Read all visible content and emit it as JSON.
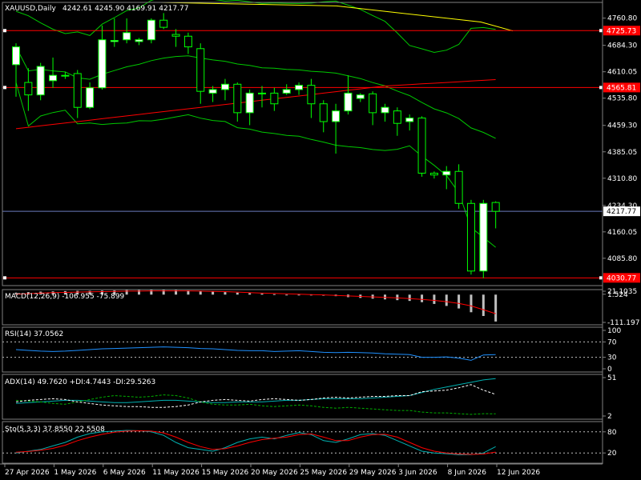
{
  "header": {
    "symbol": "XAUUSD,Daily",
    "ohlc": "4242.61 4245.90 4169.91 4217.77"
  },
  "colors": {
    "background": "#000000",
    "separator": "#808080",
    "bull": "#ffffff",
    "bear": "#000000",
    "wick": "#00ff00",
    "bollinger": "#00c800",
    "slow_ma": "#ff0000",
    "long_ma": "#ffff00",
    "hline": "#ff0000",
    "bid_line": "#6a7bbd",
    "macd_hist": "#c0c0c0",
    "macd_signal": "#ff0000",
    "rsi": "#1e90ff",
    "adx_main": "#00b0b0",
    "adx_dip": "#00b000",
    "adx_dim": "#ffffff",
    "sto_main": "#00b0b0",
    "sto_signal": "#ff0000",
    "label_red_bg": "#ff0000",
    "label_white_bg": "#ffffff"
  },
  "price_panel": {
    "ylim": [
      4009.0,
      4805.0
    ],
    "tick_labels": [
      "4760.80",
      "4684.30",
      "4610.05",
      "4535.80",
      "4459.30",
      "4385.05",
      "4310.80",
      "4234.30",
      "4160.05",
      "4085.80"
    ],
    "tick_values": [
      4760.8,
      4684.3,
      4610.05,
      4535.8,
      4459.3,
      4385.05,
      4310.8,
      4234.3,
      4160.05,
      4085.8
    ],
    "hlines": [
      {
        "label": "4725.73",
        "value": 4725.73
      },
      {
        "label": "4565.81",
        "value": 4565.81
      },
      {
        "label": "4030.77",
        "value": 4030.77
      }
    ],
    "current_price": {
      "label": "4217.77",
      "value": 4217.77
    }
  },
  "chart_data": {
    "type": "candlestick",
    "series": [
      {
        "name": "XAUUSD,Daily",
        "candles": [
          {
            "o": 4630,
            "h": 4690,
            "l": 4540,
            "c": 4680
          },
          {
            "o": 4580,
            "h": 4620,
            "l": 4500,
            "c": 4545
          },
          {
            "o": 4545,
            "h": 4635,
            "l": 4530,
            "c": 4625
          },
          {
            "o": 4585,
            "h": 4650,
            "l": 4565,
            "c": 4600
          },
          {
            "o": 4600,
            "h": 4610,
            "l": 4590,
            "c": 4598
          },
          {
            "o": 4605,
            "h": 4615,
            "l": 4480,
            "c": 4510
          },
          {
            "o": 4510,
            "h": 4580,
            "l": 4505,
            "c": 4565
          },
          {
            "o": 4565,
            "h": 4740,
            "l": 4560,
            "c": 4700
          },
          {
            "o": 4695,
            "h": 4760,
            "l": 4680,
            "c": 4698
          },
          {
            "o": 4700,
            "h": 4760,
            "l": 4690,
            "c": 4720
          },
          {
            "o": 4695,
            "h": 4705,
            "l": 4685,
            "c": 4700
          },
          {
            "o": 4700,
            "h": 4760,
            "l": 4690,
            "c": 4755
          },
          {
            "o": 4755,
            "h": 4775,
            "l": 4730,
            "c": 4735
          },
          {
            "o": 4715,
            "h": 4730,
            "l": 4680,
            "c": 4710
          },
          {
            "o": 4710,
            "h": 4720,
            "l": 4660,
            "c": 4680
          },
          {
            "o": 4675,
            "h": 4690,
            "l": 4520,
            "c": 4555
          },
          {
            "o": 4550,
            "h": 4570,
            "l": 4525,
            "c": 4560
          },
          {
            "o": 4560,
            "h": 4590,
            "l": 4530,
            "c": 4575
          },
          {
            "o": 4575,
            "h": 4580,
            "l": 4470,
            "c": 4495
          },
          {
            "o": 4495,
            "h": 4560,
            "l": 4460,
            "c": 4550
          },
          {
            "o": 4550,
            "h": 4570,
            "l": 4510,
            "c": 4548
          },
          {
            "o": 4550,
            "h": 4565,
            "l": 4500,
            "c": 4520
          },
          {
            "o": 4550,
            "h": 4575,
            "l": 4545,
            "c": 4560
          },
          {
            "o": 4560,
            "h": 4580,
            "l": 4545,
            "c": 4572
          },
          {
            "o": 4572,
            "h": 4590,
            "l": 4480,
            "c": 4520
          },
          {
            "o": 4520,
            "h": 4530,
            "l": 4440,
            "c": 4470
          },
          {
            "o": 4470,
            "h": 4520,
            "l": 4380,
            "c": 4500
          },
          {
            "o": 4500,
            "h": 4600,
            "l": 4490,
            "c": 4550
          },
          {
            "o": 4535,
            "h": 4550,
            "l": 4525,
            "c": 4545
          },
          {
            "o": 4548,
            "h": 4555,
            "l": 4460,
            "c": 4495
          },
          {
            "o": 4495,
            "h": 4520,
            "l": 4470,
            "c": 4510
          },
          {
            "o": 4500,
            "h": 4510,
            "l": 4430,
            "c": 4465
          },
          {
            "o": 4470,
            "h": 4490,
            "l": 4445,
            "c": 4480
          },
          {
            "o": 4480,
            "h": 4485,
            "l": 4315,
            "c": 4325
          },
          {
            "o": 4325,
            "h": 4330,
            "l": 4310,
            "c": 4320
          },
          {
            "o": 4320,
            "h": 4345,
            "l": 4280,
            "c": 4330
          },
          {
            "o": 4330,
            "h": 4350,
            "l": 4225,
            "c": 4240
          },
          {
            "o": 4240,
            "h": 4250,
            "l": 4040,
            "c": 4050
          },
          {
            "o": 4050,
            "h": 4250,
            "l": 4030,
            "c": 4240
          },
          {
            "o": 4242.61,
            "h": 4245.9,
            "l": 4169.91,
            "c": 4217.77
          }
        ]
      }
    ]
  },
  "time_axis": {
    "labels": [
      "27 Apr 2026",
      "1 May 2026",
      "6 May 2026",
      "11 May 2026",
      "15 May 2026",
      "20 May 2026",
      "25 May 2026",
      "29 May 2026",
      "3 Jun 2026",
      "8 Jun 2026",
      "12 Jun 2026"
    ],
    "candle_index": [
      0,
      4,
      8,
      12,
      16,
      20,
      24,
      28,
      32,
      36,
      40
    ]
  },
  "macd": {
    "label": "MACD(12,26,9) -106.955 -75.899",
    "ylim": [
      -120,
      20
    ],
    "tick_labels": [
      "21.1035",
      "1.524",
      "-111.197"
    ],
    "tick_values": [
      21.1035,
      1.524,
      -111.197
    ],
    "hist": [
      8,
      10,
      12,
      13,
      14,
      15,
      15,
      16,
      17,
      18,
      18,
      19,
      19,
      18,
      17,
      15,
      12,
      10,
      8,
      6,
      4,
      2,
      0,
      -1,
      -2,
      -4,
      -6,
      -10,
      -13,
      -16,
      -19,
      -22,
      -25,
      -30,
      -37,
      -45,
      -55,
      -70,
      -85,
      -106.955
    ],
    "signal": [
      2,
      4,
      6,
      8,
      9,
      10,
      11,
      12,
      13,
      14,
      14,
      15,
      15,
      15,
      15,
      14,
      13,
      12,
      10,
      8,
      6,
      5,
      3,
      2,
      0,
      -1,
      -3,
      -5,
      -7,
      -9,
      -11,
      -13,
      -16,
      -19,
      -23,
      -28,
      -35,
      -45,
      -60,
      -75.899
    ]
  },
  "rsi": {
    "label": "RSI(14) 37.0562",
    "tick_labels": [
      "100",
      "70",
      "30",
      "0"
    ],
    "tick_values": [
      100,
      70,
      30,
      0
    ],
    "levels": [
      70,
      30
    ],
    "values": [
      50,
      48,
      46,
      45,
      46,
      48,
      50,
      52,
      53,
      54,
      55,
      56,
      57,
      56,
      55,
      53,
      52,
      50,
      48,
      47,
      47,
      45,
      46,
      47,
      45,
      43,
      42,
      43,
      42,
      41,
      39,
      38,
      37,
      30,
      30,
      31,
      28,
      22,
      36,
      37.0562
    ]
  },
  "adx": {
    "label": "ADX(14) 49.7620 +DI:4.7443 -DI:29.5263",
    "tick_labels": [
      "51",
      "2"
    ],
    "tick_values": [
      51,
      2
    ],
    "ylim": [
      2,
      51
    ],
    "main": [
      18,
      19,
      20,
      21,
      22,
      22,
      21,
      20,
      19,
      19,
      20,
      21,
      22,
      22,
      21,
      20,
      19,
      19,
      20,
      20,
      20,
      21,
      22,
      22,
      23,
      24,
      24,
      24,
      24,
      25,
      26,
      27,
      28,
      32,
      36,
      39,
      42,
      45,
      48,
      49.762
    ],
    "plus_di": [
      22,
      21,
      20,
      18,
      17,
      20,
      23,
      26,
      28,
      27,
      26,
      27,
      29,
      28,
      25,
      20,
      17,
      16,
      16,
      17,
      15,
      14,
      15,
      16,
      15,
      13,
      12,
      13,
      12,
      11,
      10,
      9,
      9,
      7,
      6,
      6,
      5,
      4,
      5,
      4.7443
    ],
    "minus_di": [
      20,
      22,
      23,
      24,
      23,
      20,
      18,
      16,
      15,
      14,
      14,
      13,
      13,
      14,
      16,
      20,
      22,
      23,
      22,
      21,
      23,
      24,
      23,
      22,
      23,
      25,
      26,
      25,
      26,
      27,
      27,
      28,
      28,
      33,
      34,
      35,
      38,
      42,
      35,
      29.5263
    ]
  },
  "sto": {
    "label": "Sto(5,3,3) 37.8550 22.5508",
    "tick_labels": [
      "80",
      "20"
    ],
    "tick_values": [
      80,
      20
    ],
    "levels": [
      80,
      20
    ],
    "main": [
      20,
      25,
      30,
      40,
      50,
      65,
      75,
      80,
      82,
      84,
      83,
      80,
      70,
      50,
      35,
      30,
      25,
      35,
      50,
      60,
      65,
      60,
      70,
      78,
      72,
      55,
      50,
      60,
      72,
      75,
      70,
      55,
      40,
      25,
      20,
      18,
      15,
      15,
      20,
      37.855
    ],
    "signal": [
      22,
      24,
      28,
      33,
      42,
      55,
      65,
      73,
      79,
      82,
      83,
      82,
      77,
      65,
      50,
      38,
      30,
      32,
      40,
      50,
      58,
      62,
      65,
      72,
      74,
      65,
      55,
      55,
      65,
      72,
      73,
      65,
      50,
      35,
      25,
      20,
      17,
      16,
      17,
      22.5508
    ]
  }
}
